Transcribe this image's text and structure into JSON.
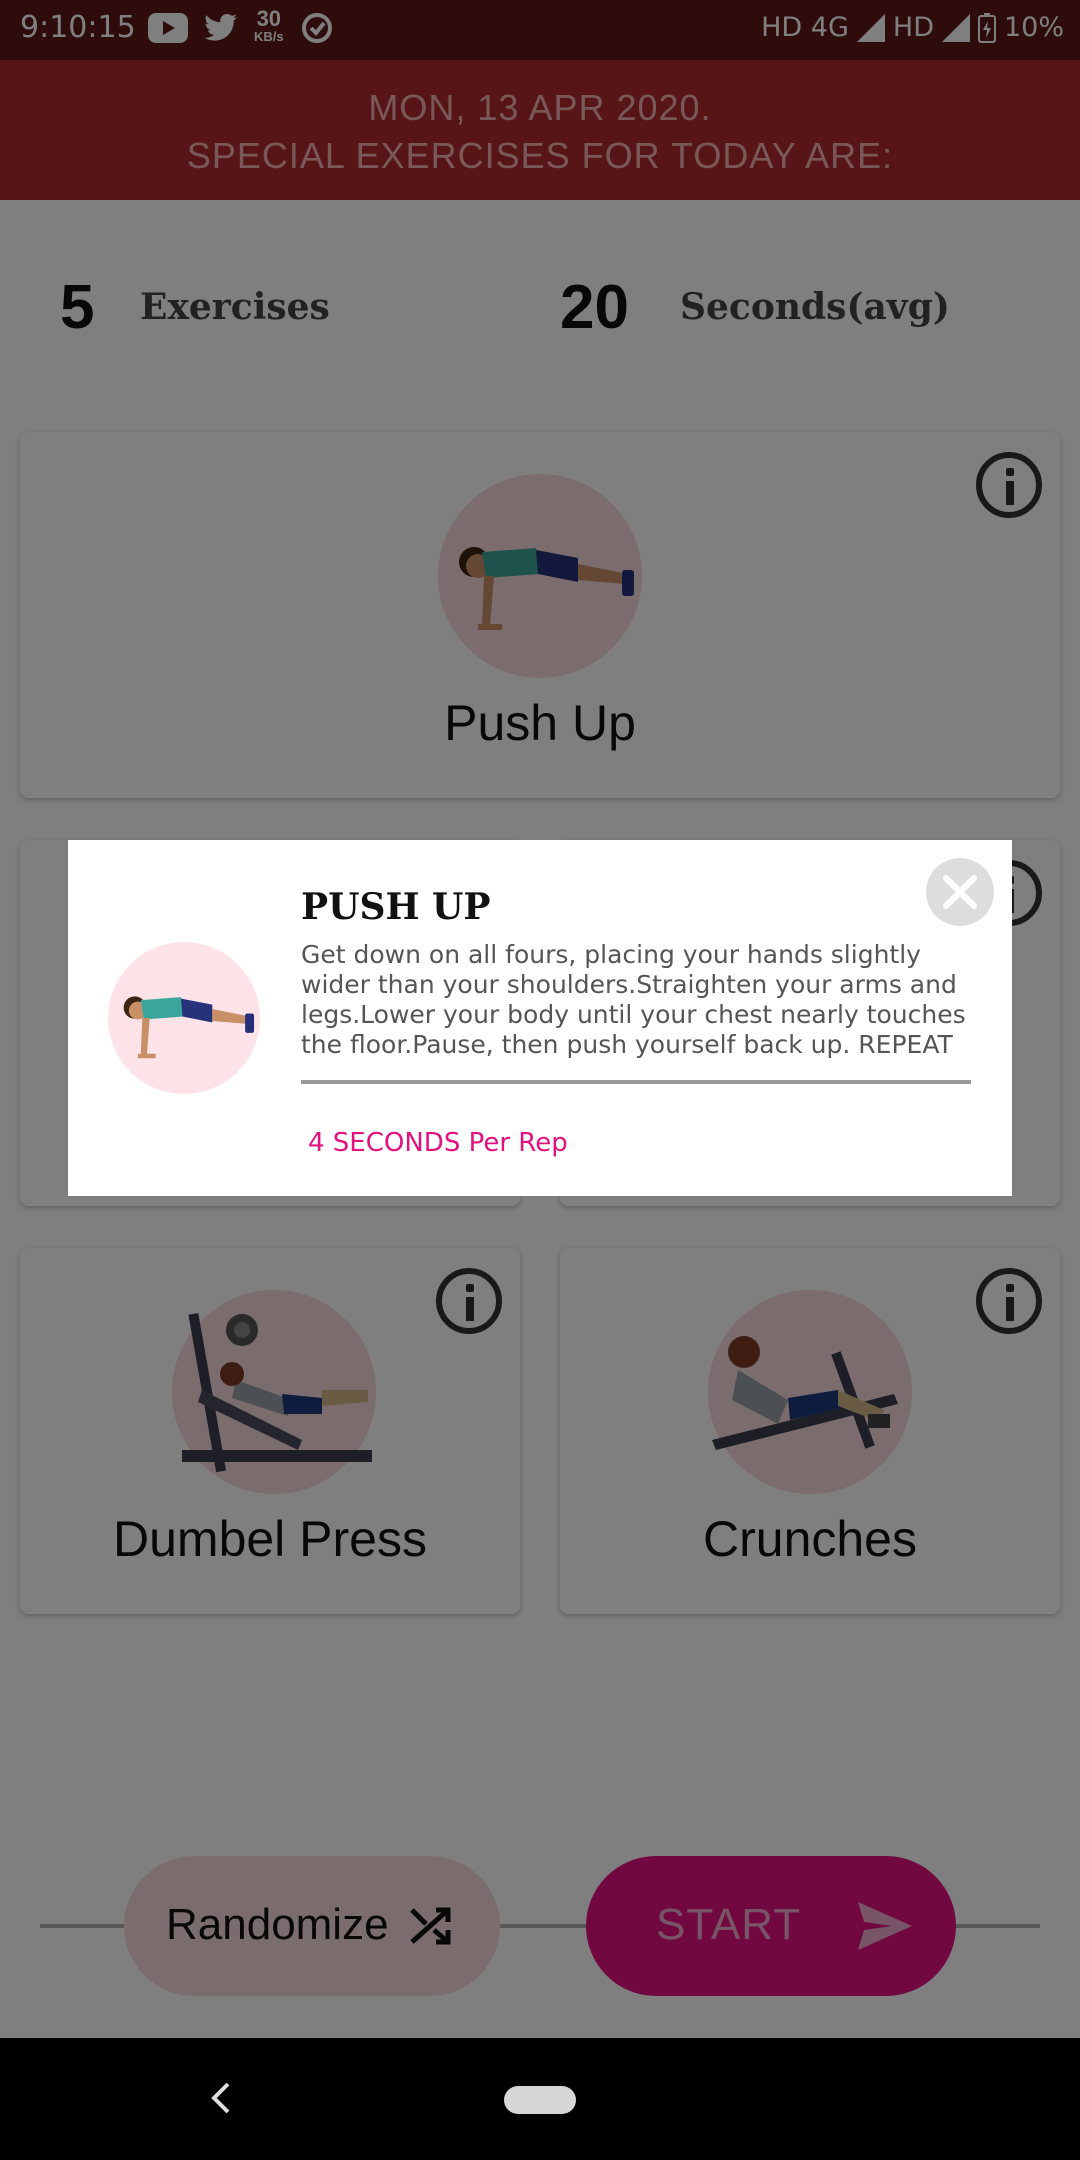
{
  "status_bar": {
    "time": "9:10:15",
    "speed_value": "30",
    "speed_unit": "KB/s",
    "network": "HD 4G",
    "network2": "HD",
    "battery": "10%",
    "icons": [
      "youtube-icon",
      "twitter-icon",
      "data-saver-icon",
      "signal-icon",
      "battery-icon"
    ]
  },
  "header": {
    "date": "MON, 13 APR 2020.",
    "subtitle": "SPECIAL EXERCISES FOR TODAY ARE:"
  },
  "stats": {
    "exercises_count": "5",
    "exercises_label": "Exercises",
    "seconds_count": "20",
    "seconds_label": "Seconds(avg)"
  },
  "exercises": [
    {
      "name": "Push Up"
    },
    {
      "name": ""
    },
    {
      "name": ""
    },
    {
      "name": "Dumbel Press"
    },
    {
      "name": "Crunches"
    }
  ],
  "actions": {
    "randomize_label": "Randomize",
    "start_label": "START"
  },
  "dialog": {
    "title": "PUSH UP",
    "description": "Get down on all fours, placing your hands slightly wider than your shoulders.Straighten your arms and legs.Lower your body until your chest nearly touches the floor.Pause, then push yourself back up. REPEAT",
    "rep_info": "4 SECONDS Per Rep"
  },
  "colors": {
    "status_bar": "#5e1818",
    "banner": "#b12a2f",
    "accent_pink": "#e3107e",
    "circle_bg": "#f7d9dd"
  }
}
